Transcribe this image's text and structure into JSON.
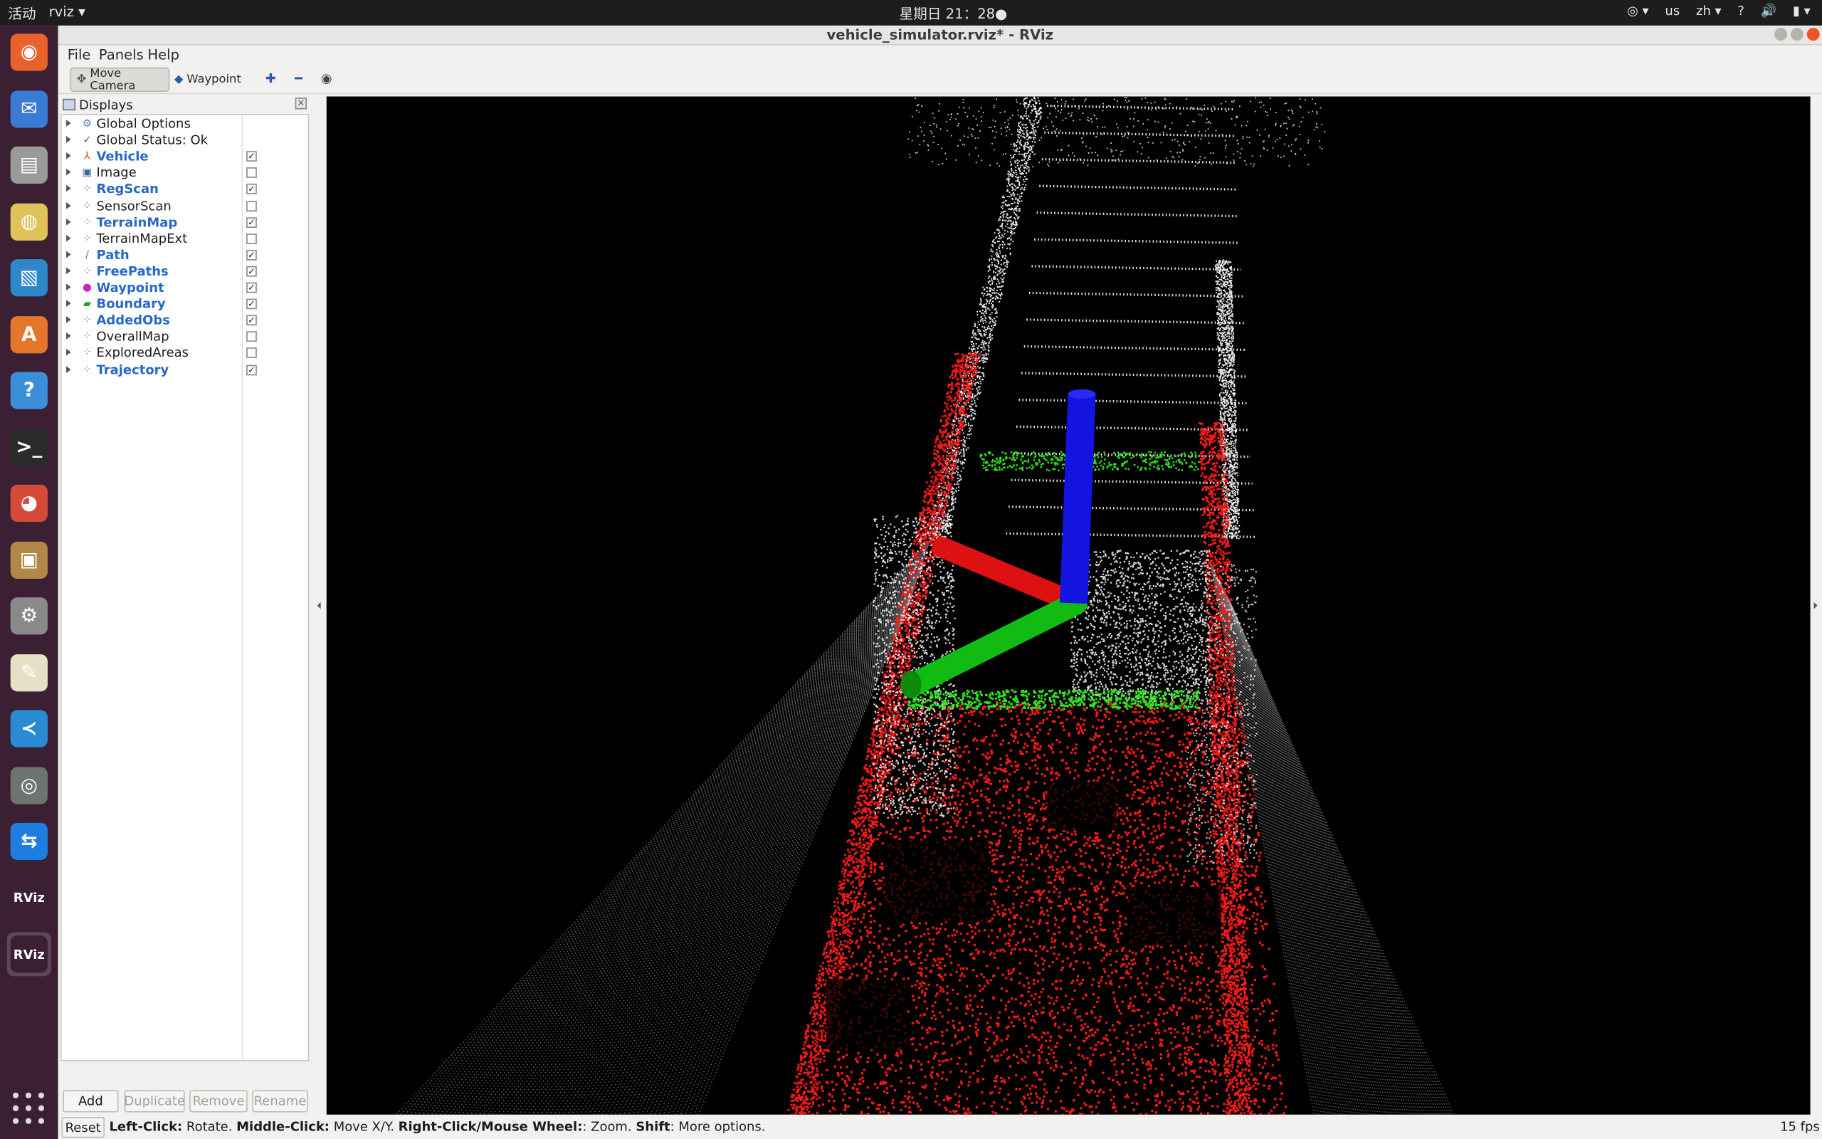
{
  "topbar": {
    "activities": "活动",
    "app_menu": "rviz ▾",
    "clock": "星期日 21：28●",
    "tray": [
      "◎ ▾",
      "us",
      "zh ▾",
      "?",
      "🔊",
      "▮ ▾"
    ]
  },
  "dock": {
    "items": [
      {
        "name": "firefox",
        "glyph": "◉",
        "color": "#e8622c"
      },
      {
        "name": "thunderbird",
        "glyph": "✉",
        "color": "#3a7bd5"
      },
      {
        "name": "files",
        "glyph": "▤",
        "color": "#9a9a9a"
      },
      {
        "name": "rhythmbox",
        "glyph": "◍",
        "color": "#e0c25a"
      },
      {
        "name": "libreoffice-impress",
        "glyph": "▧",
        "color": "#2e87c8"
      },
      {
        "name": "software-center",
        "glyph": "A",
        "color": "#e4772b"
      },
      {
        "name": "help",
        "glyph": "?",
        "color": "#3b8ed8"
      },
      {
        "name": "terminal",
        "glyph": ">_",
        "color": "#2b2b2b"
      },
      {
        "name": "chrome",
        "glyph": "◕",
        "color": "#d64a3a"
      },
      {
        "name": "archive",
        "glyph": "▣",
        "color": "#b1884a"
      },
      {
        "name": "system-tools",
        "glyph": "⚙",
        "color": "#8a8a8a"
      },
      {
        "name": "text-editor",
        "glyph": "✎",
        "color": "#e6e0c6"
      },
      {
        "name": "vscode",
        "glyph": "≺",
        "color": "#2a8ad4"
      },
      {
        "name": "eye-of-gnome",
        "glyph": "◎",
        "color": "#6e7470"
      },
      {
        "name": "teamviewer",
        "glyph": "⇆",
        "color": "#1d7ee0"
      },
      {
        "name": "rviz-1",
        "glyph": "RViz",
        "color": "#3b1f33"
      },
      {
        "name": "rviz-2",
        "glyph": "RViz",
        "color": "#3b1f33"
      }
    ]
  },
  "window": {
    "title": "vehicle_simulator.rviz* - RViz"
  },
  "menu": {
    "file": "File",
    "panels": "Panels",
    "help": "Help"
  },
  "toolbar": {
    "move_camera": "Move Camera",
    "waypoint": "Waypoint"
  },
  "displays": {
    "title": "Displays",
    "items": [
      {
        "label": "Global Options",
        "icon": "⚙",
        "icon_color": "#5b7fb5",
        "checked": null,
        "bold": false
      },
      {
        "label": "Global Status: Ok",
        "icon": "✓",
        "icon_color": "#2d7a2d",
        "checked": null,
        "bold": false
      },
      {
        "label": "Vehicle",
        "icon": "⅄",
        "icon_color": "#c84a2a",
        "checked": true,
        "bold": true
      },
      {
        "label": "Image",
        "icon": "▣",
        "icon_color": "#3a64a8",
        "checked": false,
        "bold": false
      },
      {
        "label": "RegScan",
        "icon": "⁘",
        "icon_color": "#4d7fb8",
        "checked": true,
        "bold": true
      },
      {
        "label": "SensorScan",
        "icon": "⁘",
        "icon_color": "#4d7fb8",
        "checked": false,
        "bold": false
      },
      {
        "label": "TerrainMap",
        "icon": "⁘",
        "icon_color": "#4d7fb8",
        "checked": true,
        "bold": true
      },
      {
        "label": "TerrainMapExt",
        "icon": "⁘",
        "icon_color": "#4d7fb8",
        "checked": false,
        "bold": false
      },
      {
        "label": "Path",
        "icon": "∕",
        "icon_color": "#2aa52a",
        "checked": true,
        "bold": true
      },
      {
        "label": "FreePaths",
        "icon": "⁘",
        "icon_color": "#4d7fb8",
        "checked": true,
        "bold": true
      },
      {
        "label": "Waypoint",
        "icon": "●",
        "icon_color": "#d020c8",
        "checked": true,
        "bold": true
      },
      {
        "label": "Boundary",
        "icon": "▰",
        "icon_color": "#1e9e1e",
        "checked": true,
        "bold": true
      },
      {
        "label": "AddedObs",
        "icon": "⁘",
        "icon_color": "#4d7fb8",
        "checked": true,
        "bold": true
      },
      {
        "label": "OverallMap",
        "icon": "⁘",
        "icon_color": "#4d7fb8",
        "checked": false,
        "bold": false
      },
      {
        "label": "ExploredAreas",
        "icon": "⁘",
        "icon_color": "#4d7fb8",
        "checked": false,
        "bold": false
      },
      {
        "label": "Trajectory",
        "icon": "⁘",
        "icon_color": "#4d7fb8",
        "checked": true,
        "bold": true
      }
    ],
    "buttons": {
      "add": "Add",
      "duplicate": "Duplicate",
      "remove": "Remove",
      "rename": "Rename"
    }
  },
  "statusbar": {
    "reset": "Reset",
    "hint_segments": [
      {
        "text": "Left-Click:",
        "bold": true
      },
      {
        "text": " Rotate. ",
        "bold": false
      },
      {
        "text": "Middle-Click:",
        "bold": true
      },
      {
        "text": " Move X/Y. ",
        "bold": false
      },
      {
        "text": "Right-Click/Mouse Wheel:",
        "bold": true
      },
      {
        "text": ": Zoom. ",
        "bold": false
      },
      {
        "text": "Shift",
        "bold": true
      },
      {
        "text": ": More options.",
        "bold": false
      }
    ],
    "fps": "15 fps"
  },
  "colors": {
    "point_white": "#ffffff",
    "point_red": "#ff1a1a",
    "point_green": "#33ee22",
    "axis_x": "#dd1111",
    "axis_y": "#11bb11",
    "axis_z": "#1414e0"
  }
}
